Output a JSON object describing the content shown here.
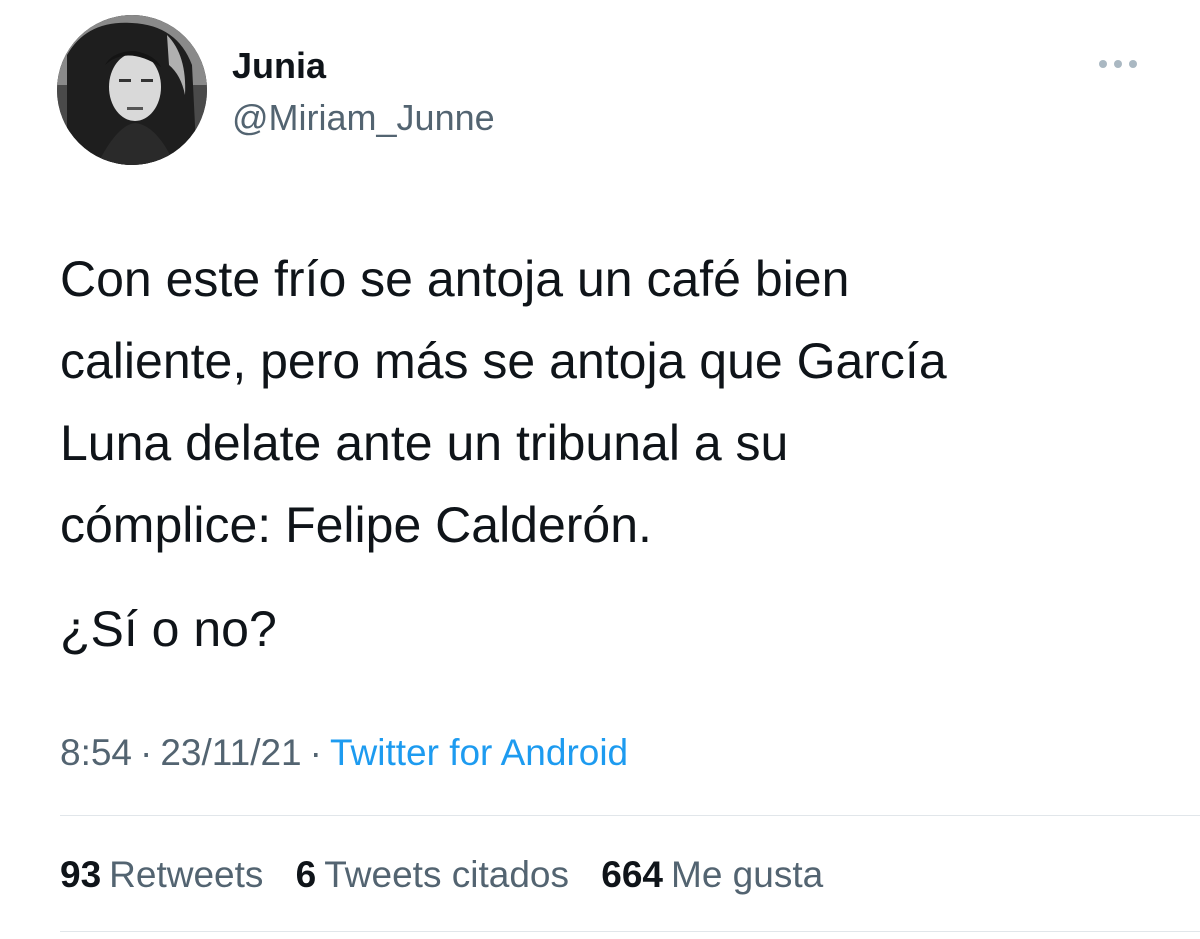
{
  "user": {
    "display_name": "Junia",
    "handle": "@Miriam_Junne",
    "avatar_icon": "profile-photo"
  },
  "menu": {
    "icon": "more-horizontal-icon"
  },
  "tweet": {
    "lines": [
      "Con este frío se antoja un café bien",
      "caliente, pero más se antoja que García",
      "Luna delate ante un tribunal a su",
      "cómplice: Felipe Calderón."
    ],
    "question": "¿Sí o no?"
  },
  "meta": {
    "time": "8:54",
    "separator": "·",
    "date": "23/11/21",
    "source": "Twitter for Android"
  },
  "stats": {
    "retweets": {
      "count": "93",
      "label": "Retweets"
    },
    "quotes": {
      "count": "6",
      "label": "Tweets citados"
    },
    "likes": {
      "count": "664",
      "label": "Me gusta"
    }
  },
  "colors": {
    "text_primary": "#0f1419",
    "text_secondary": "#536471",
    "link": "#1d9bf0",
    "divider": "#e1e6ea"
  }
}
